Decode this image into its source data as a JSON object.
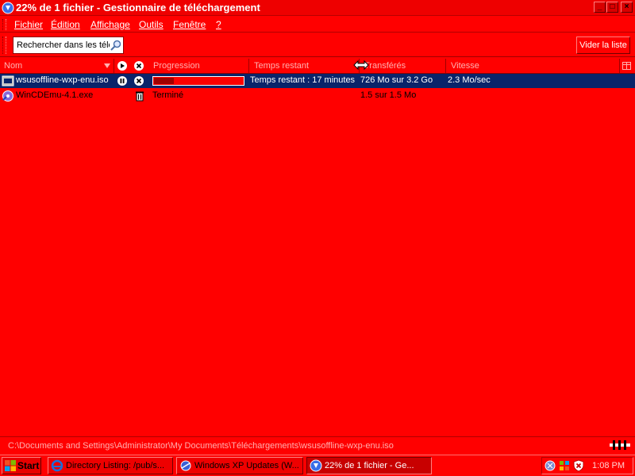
{
  "window": {
    "title": "22% de 1 fichier - Gestionnaire de téléchargement",
    "controls": {
      "minimize": "_",
      "maximize": "□",
      "close": "×"
    }
  },
  "menu": {
    "items": [
      "Fichier",
      "Édition",
      "Affichage",
      "Outils",
      "Fenêtre",
      "?"
    ]
  },
  "toolbar": {
    "search_value": "Rechercher dans les télé",
    "clear_label": "Vider la liste"
  },
  "columns": {
    "name": "Nom",
    "progress": "Progression",
    "time_remaining": "Temps restant",
    "transferred": "Transférés",
    "speed": "Vitesse"
  },
  "downloads": [
    {
      "name": "wsusoffline-wxp-enu.iso",
      "progress_fraction": 0.22,
      "time_remaining": "Temps restant : 17 minutes",
      "transferred": "726 Mo sur 3.2 Go",
      "speed": "2.3 Mo/sec",
      "selected": true
    },
    {
      "name": "WinCDEmu-4.1.exe",
      "status": "Terminé",
      "transferred": "1.5 sur 1.5 Mo",
      "selected": false
    }
  ],
  "statusbar": {
    "path": "C:\\Documents and Settings\\Administrator\\My Documents\\Téléchargements\\wsusoffline-wxp-enu.iso"
  },
  "taskbar": {
    "start_label": "Start",
    "tasks": [
      {
        "label": "Directory Listing: /pub/s...",
        "active": false
      },
      {
        "label": "Windows XP Updates (W...",
        "active": false
      },
      {
        "label": "22% de 1 fichier - Ge...",
        "active": true
      }
    ],
    "clock": "1:08 PM"
  },
  "colors": {
    "background": "#ff0000",
    "selection": "#0a246a"
  }
}
